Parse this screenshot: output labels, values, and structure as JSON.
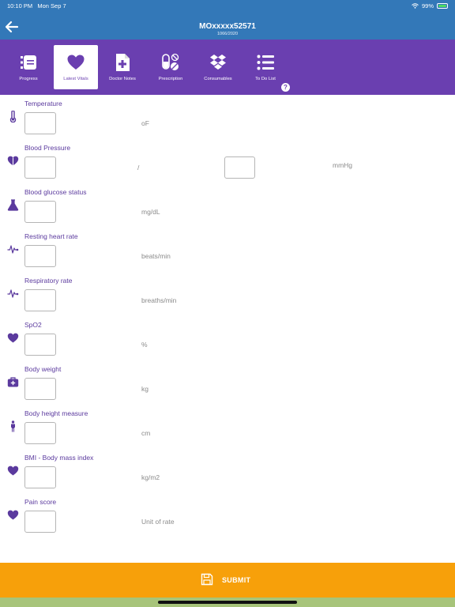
{
  "status_bar": {
    "time": "10:10 PM",
    "date": "Mon Sep 7",
    "battery": "99%"
  },
  "header": {
    "title": "MOxxxxx52571",
    "subtitle": "1066/2020"
  },
  "tabs": [
    {
      "label": "Progress",
      "icon": "progress-list-icon"
    },
    {
      "label": "Latest Vitals",
      "icon": "heart-icon",
      "active": true
    },
    {
      "label": "Doctor Notes",
      "icon": "doctor-notes-icon"
    },
    {
      "label": "Prescription",
      "icon": "pills-icon"
    },
    {
      "label": "Consumables",
      "icon": "dropbox-icon"
    },
    {
      "label": "To Do List",
      "icon": "todo-list-icon"
    }
  ],
  "help_label": "?",
  "vitals": [
    {
      "label": "Temperature",
      "unit": "oF",
      "value": "",
      "icon": "thermometer-icon"
    },
    {
      "label": "Blood Pressure",
      "unit": "/",
      "unit2": "mmHg",
      "value": "",
      "value2": "",
      "icon": "heart-shield-icon"
    },
    {
      "label": "Blood glucose status",
      "unit": "mg/dL",
      "value": "",
      "icon": "flask-icon"
    },
    {
      "label": "Resting heart rate",
      "unit": "beats/min",
      "value": "",
      "icon": "heartbeat-icon"
    },
    {
      "label": "Respiratory rate",
      "unit": "breaths/min",
      "value": "",
      "icon": "heartbeat-icon"
    },
    {
      "label": "SpO2",
      "unit": "%",
      "value": "",
      "icon": "heart-icon"
    },
    {
      "label": "Body weight",
      "unit": "kg",
      "value": "",
      "icon": "medkit-icon"
    },
    {
      "label": "Body height measure",
      "unit": "cm",
      "value": "",
      "icon": "person-icon"
    },
    {
      "label": "BMI - Body mass index",
      "unit": "kg/m2",
      "value": "",
      "icon": "heart-icon"
    },
    {
      "label": "Pain score",
      "unit": "Unit of rate",
      "value": "",
      "icon": "heart-icon"
    }
  ],
  "submit": {
    "label": "SUBMIT",
    "icon": "save-icon"
  },
  "colors": {
    "header_blue": "#3378b8",
    "tab_purple": "#6a3fb0",
    "submit_orange": "#f7a00a",
    "label_purple": "#5b3a9e"
  }
}
